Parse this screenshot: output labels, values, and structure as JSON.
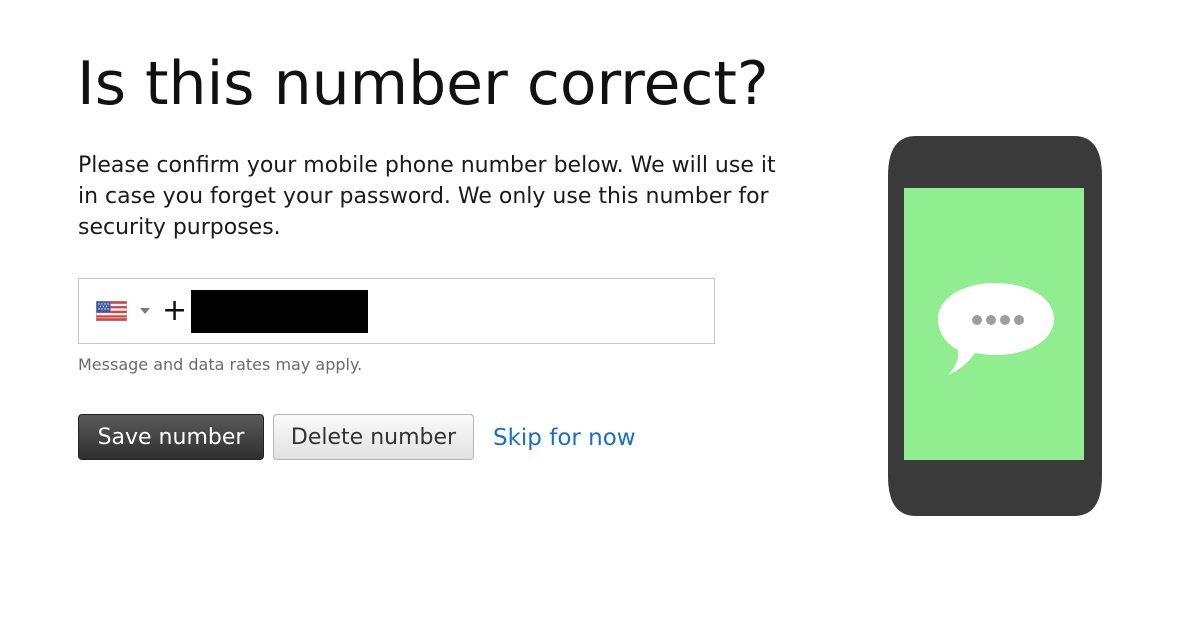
{
  "header": {
    "title": "Is this number correct?"
  },
  "main": {
    "description": "Please confirm your mobile phone number below. We will use it in case you forget your password. We only use this number for security purposes.",
    "phone_field": {
      "country_flag": "us-flag-icon",
      "prefix": "+",
      "number": "[redacted]"
    },
    "note": "Message and data rates may apply."
  },
  "actions": {
    "save_label": "Save number",
    "delete_label": "Delete number",
    "skip_label": "Skip for now"
  },
  "illustration": {
    "icon": "phone-message-icon",
    "screen_color": "#90ee90",
    "body_color": "#3a3a3a"
  },
  "colors": {
    "link": "#1a6fc4",
    "primary_button": "#3c3c3c"
  }
}
